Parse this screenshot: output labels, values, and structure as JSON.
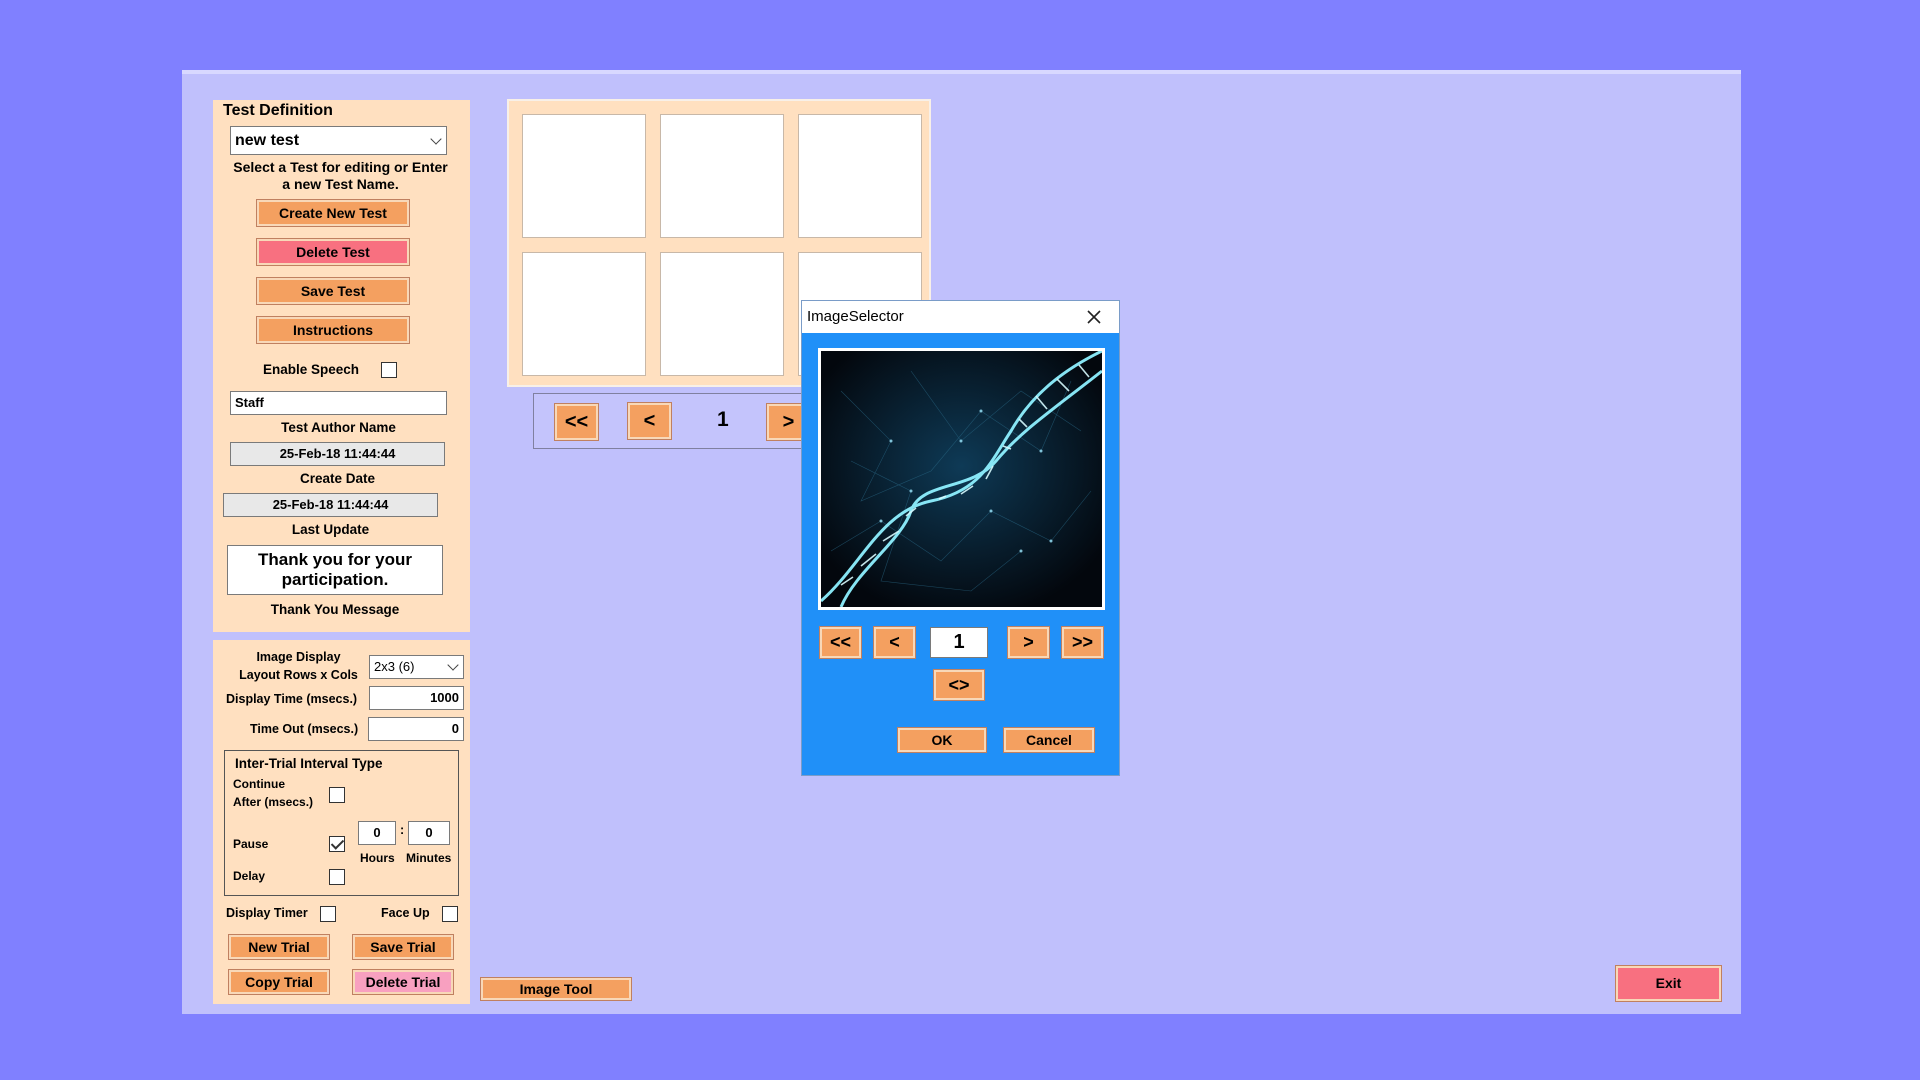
{
  "test_definition": {
    "title": "Test Definition",
    "test_name_value": "new test",
    "instructions_text": "Select a Test for editing or Enter a new Test Name.",
    "create_button": "Create New Test",
    "delete_button": "Delete Test",
    "save_button": "Save Test",
    "instructions_button": "Instructions",
    "enable_speech_label": "Enable Speech",
    "enable_speech_checked": false,
    "author_value": "Staff",
    "author_label": "Test Author Name",
    "create_date_value": "25-Feb-18 11:44:44",
    "create_date_label": "Create Date",
    "last_update_value": "25-Feb-18 11:44:44",
    "last_update_label": "Last Update",
    "thank_you_value": "Thank you for your participation.",
    "thank_you_label": "Thank You Message"
  },
  "trial_settings": {
    "layout_label_line1": "Image Display",
    "layout_label_line2": "Layout Rows x Cols",
    "layout_value": "2x3 (6)",
    "display_time_label": "Display Time (msecs.)",
    "display_time_value": "1000",
    "timeout_label": "Time Out (msecs.)",
    "timeout_value": "0",
    "iti_title": "Inter-Trial Interval Type",
    "continue_label_line1": "Continue",
    "continue_label_line2": "After (msecs.)",
    "pause_label": "Pause",
    "delay_label": "Delay",
    "hours_value": "0",
    "minutes_value": "0",
    "colon": ":",
    "hours_label": "Hours",
    "minutes_label": "Minutes",
    "display_timer_label": "Display Timer",
    "face_up_label": "Face Up",
    "new_trial_button": "New Trial",
    "save_trial_button": "Save Trial",
    "copy_trial_button": "Copy Trial",
    "delete_trial_button": "Delete Trial"
  },
  "grid_nav": {
    "first": "<<",
    "prev": "<",
    "page": "1",
    "next": ">"
  },
  "image_tool_button": "Image Tool",
  "exit_button": "Exit",
  "dialog": {
    "title": "ImageSelector",
    "first": "<<",
    "prev": "<",
    "index_value": "1",
    "next": ">",
    "last": ">>",
    "swap": "<>",
    "ok": "OK",
    "cancel": "Cancel",
    "image_icon": "dna-helix-image"
  },
  "colors": {
    "desktop": "#8080ff",
    "app_bg": "#c0c0fc",
    "panel": "#ffe0c0",
    "button": "#f4a060",
    "danger": "#f87080",
    "dialog": "#2090f8"
  }
}
